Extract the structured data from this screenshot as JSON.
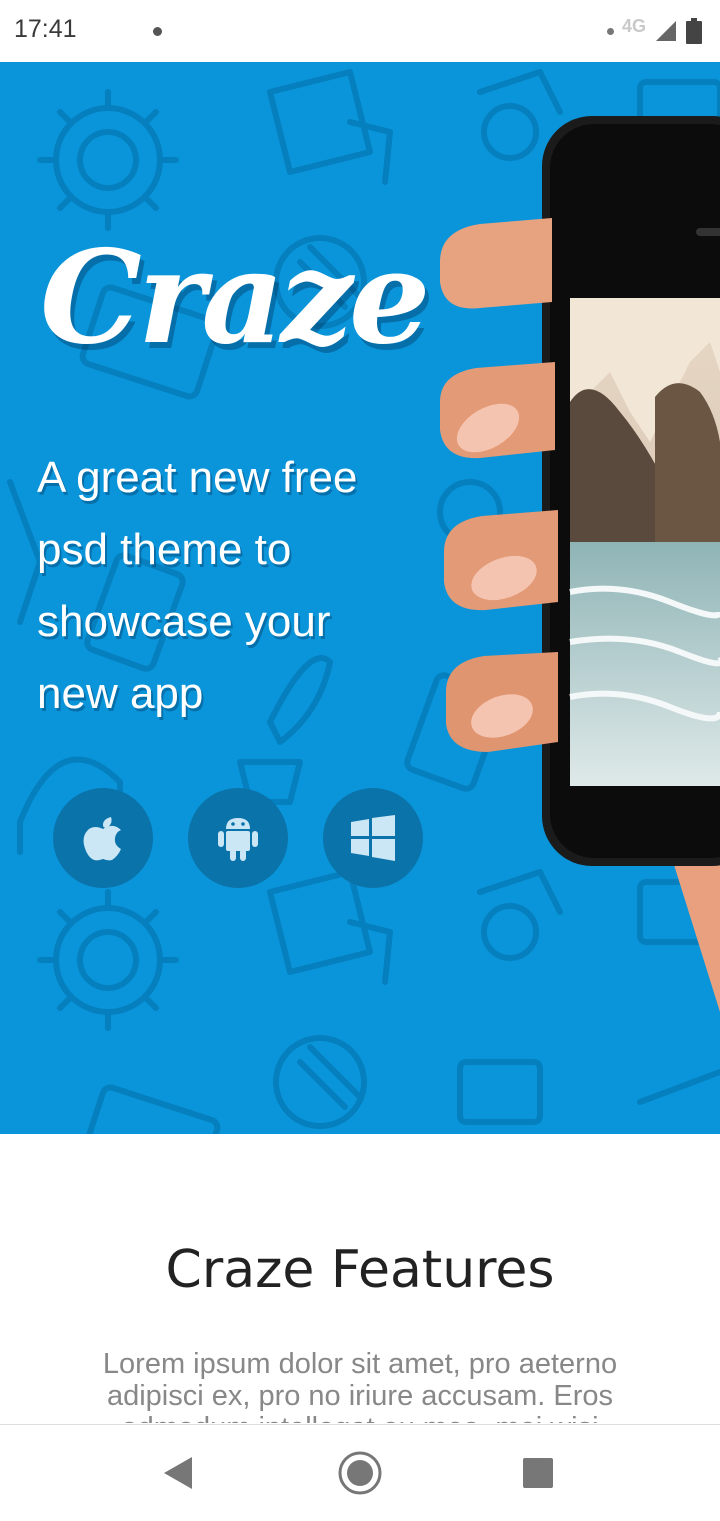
{
  "status_bar": {
    "time": "17:41",
    "network": "4G",
    "icons": [
      "notification-dot-icon",
      "signal-icon",
      "battery-icon"
    ]
  },
  "hero": {
    "logo_text": "Craze",
    "tagline": "A great new free psd theme to showcase your new app",
    "platforms": [
      "apple-icon",
      "android-icon",
      "windows-icon"
    ],
    "background_color": "#0a95da",
    "button_color": "#0a73aa"
  },
  "features": {
    "title": "Craze Features",
    "text": "Lorem ipsum dolor sit amet, pro aeterno adipisci ex, pro no iriure accusam. Eros admodum intellegat eu mea, mei wisi"
  },
  "nav_bar": {
    "buttons": [
      "back-icon",
      "home-icon",
      "recents-icon"
    ]
  }
}
